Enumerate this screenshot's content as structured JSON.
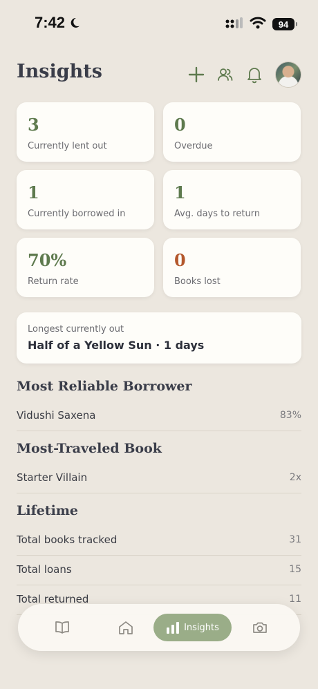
{
  "status": {
    "time": "7:42",
    "battery": "94"
  },
  "header": {
    "title": "Insights"
  },
  "stats": [
    {
      "value": "3",
      "label": "Currently lent out"
    },
    {
      "value": "0",
      "label": "Overdue"
    },
    {
      "value": "1",
      "label": "Currently borrowed in"
    },
    {
      "value": "1",
      "label": "Avg. days to return"
    },
    {
      "value": "70%",
      "label": "Return rate"
    },
    {
      "value": "0",
      "label": "Books lost"
    }
  ],
  "longest": {
    "label": "Longest currently out",
    "value": "Half of a Yellow Sun · 1 days"
  },
  "reliable": {
    "title": "Most Reliable Borrower",
    "name": "Vidushi Saxena",
    "value": "83%"
  },
  "traveled": {
    "title": "Most-Traveled Book",
    "name": "Starter Villain",
    "value": "2x"
  },
  "lifetime": {
    "title": "Lifetime",
    "rows": [
      {
        "label": "Total books tracked",
        "value": "31"
      },
      {
        "label": "Total loans",
        "value": "15"
      },
      {
        "label": "Total returned",
        "value": "11"
      }
    ]
  },
  "tabbar": {
    "active_label": "Insights"
  },
  "colors": {
    "accent": "#5e7a4e",
    "alert": "#b4582d",
    "active_tab": "#9aad88",
    "background": "#ece7df"
  }
}
